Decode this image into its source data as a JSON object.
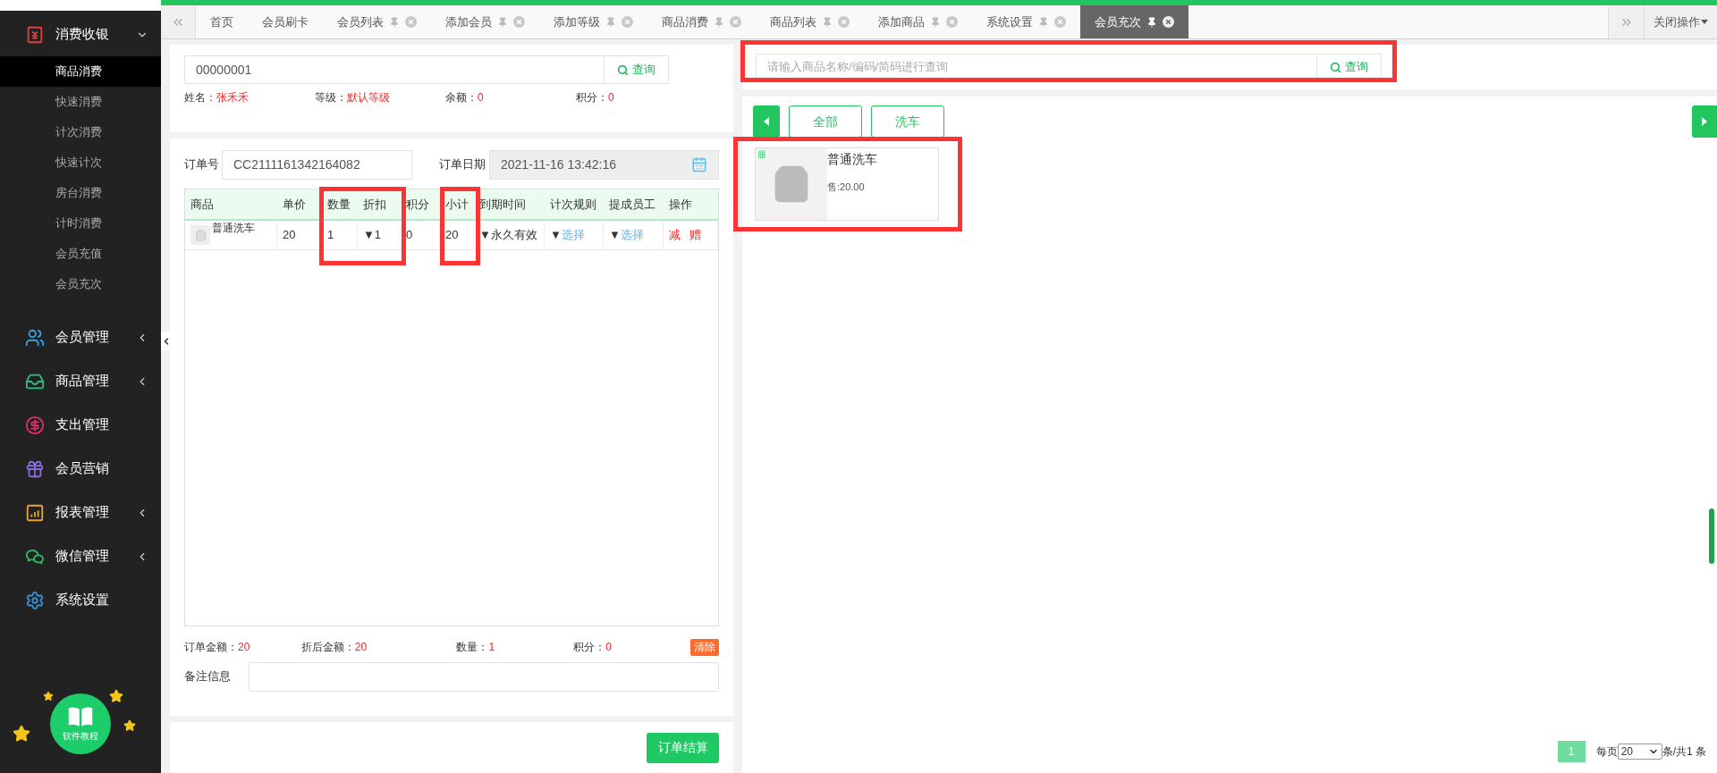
{
  "sidebar": {
    "groups": [
      {
        "label": "消费收银",
        "expanded": true,
        "children": [
          {
            "label": "商品消费",
            "selected": true
          },
          {
            "label": "快速消费",
            "selected": false
          },
          {
            "label": "计次消费",
            "selected": false
          },
          {
            "label": "快速计次",
            "selected": false
          },
          {
            "label": "房台消费",
            "selected": false
          },
          {
            "label": "计时消费",
            "selected": false
          },
          {
            "label": "会员充值",
            "selected": false
          },
          {
            "label": "会员充次",
            "selected": false
          }
        ]
      },
      {
        "label": "会员管理",
        "expanded": false
      },
      {
        "label": "商品管理",
        "expanded": false
      },
      {
        "label": "支出管理"
      },
      {
        "label": "会员营销"
      },
      {
        "label": "报表管理",
        "expanded": false
      },
      {
        "label": "微信管理",
        "expanded": false
      },
      {
        "label": "系统设置"
      }
    ],
    "help_button": "软件教程"
  },
  "tabs": [
    {
      "label": "首页",
      "closable": false,
      "selected": false
    },
    {
      "label": "会员刷卡",
      "closable": false,
      "selected": false
    },
    {
      "label": "会员列表",
      "closable": true,
      "selected": false
    },
    {
      "label": "添加会员",
      "closable": true,
      "selected": false
    },
    {
      "label": "添加等级",
      "closable": true,
      "selected": false
    },
    {
      "label": "商品消费",
      "closable": true,
      "selected": false
    },
    {
      "label": "商品列表",
      "closable": true,
      "selected": false
    },
    {
      "label": "添加商品",
      "closable": true,
      "selected": false
    },
    {
      "label": "系统设置",
      "closable": true,
      "selected": false
    },
    {
      "label": "会员充次",
      "closable": true,
      "selected": true
    }
  ],
  "tab_menu": "关闭操作",
  "member": {
    "search_value": "00000001",
    "search_button": "查询",
    "info": [
      {
        "label": "姓名：",
        "value": "张禾禾"
      },
      {
        "label": "等级：",
        "value": "默认等级"
      },
      {
        "label": "余额：",
        "value": "0"
      },
      {
        "label": "积分：",
        "value": "0"
      }
    ]
  },
  "order": {
    "number_label": "订单号",
    "number": "CC2111161342164082",
    "date_label": "订单日期",
    "date": "2021-11-16 13:42:16",
    "table": {
      "columns": [
        "商品",
        "单价",
        "数量",
        "折扣",
        "积分",
        "小计",
        "到期时间",
        "计次规则",
        "提成员工",
        "操作"
      ],
      "rows": [
        {
          "cells": [
            {
              "text": "普通洗车"
            },
            {
              "text": "20"
            },
            {
              "text": "1"
            },
            {
              "text": "▼1"
            },
            {
              "text": "0"
            },
            {
              "text": "20"
            },
            {
              "text": "▼永久有效"
            },
            {
              "prefix": "▼",
              "link": "选择"
            },
            {
              "prefix": "▼",
              "link": "选择"
            },
            {
              "actions": [
                "减",
                "赠"
              ]
            }
          ]
        }
      ]
    },
    "summary": [
      {
        "label": "订单金额：",
        "value": "20"
      },
      {
        "label": "折后金额：",
        "value": "20"
      },
      {
        "label": "数量：",
        "value": "1"
      },
      {
        "label": "积分：",
        "value": "0"
      }
    ],
    "clear_button": "清除",
    "remark_label": "备注信息",
    "submit_button": "订单结算"
  },
  "products": {
    "search_placeholder": "请输入商品名称/编码/简码进行查询",
    "search_button": "查询",
    "categories": [
      "全部",
      "洗车"
    ],
    "items": [
      {
        "tag": "服",
        "name": "普通洗车",
        "price": "售:20.00"
      }
    ],
    "pagination": {
      "pages": [
        {
          "label": "1",
          "selected": true
        }
      ],
      "per_page_label": "每页",
      "per_page": "20",
      "total": "条/共1 条"
    }
  }
}
